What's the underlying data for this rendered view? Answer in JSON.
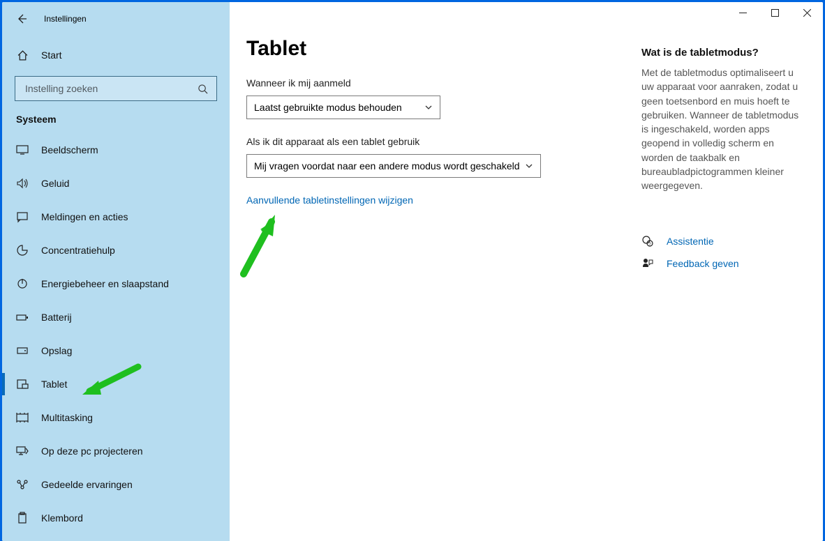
{
  "window": {
    "title": "Instellingen"
  },
  "sidebar": {
    "home": "Start",
    "search_placeholder": "Instelling zoeken",
    "category": "Systeem",
    "items": [
      {
        "label": "Beeldscherm"
      },
      {
        "label": "Geluid"
      },
      {
        "label": "Meldingen en acties"
      },
      {
        "label": "Concentratiehulp"
      },
      {
        "label": "Energiebeheer en slaapstand"
      },
      {
        "label": "Batterij"
      },
      {
        "label": "Opslag"
      },
      {
        "label": "Tablet",
        "selected": true
      },
      {
        "label": "Multitasking"
      },
      {
        "label": "Op deze pc projecteren"
      },
      {
        "label": "Gedeelde ervaringen"
      },
      {
        "label": "Klembord"
      }
    ]
  },
  "page": {
    "title": "Tablet",
    "setting1_label": "Wanneer ik mij aanmeld",
    "setting1_value": "Laatst gebruikte modus behouden",
    "setting2_label": "Als ik dit apparaat als een tablet gebruik",
    "setting2_value": "Mij vragen voordat naar een andere modus wordt geschakeld",
    "link_more": "Aanvullende tabletinstellingen wijzigen"
  },
  "info": {
    "title": "Wat is de tabletmodus?",
    "text": "Met de tabletmodus optimaliseert u uw apparaat voor aanraken, zodat u geen toetsenbord en muis hoeft te gebruiken. Wanneer de tabletmodus is ingeschakeld, worden apps geopend in volledig scherm en worden de taakbalk en bureaubladpictogrammen kleiner weergegeven."
  },
  "support": {
    "help": "Assistentie",
    "feedback": "Feedback geven"
  }
}
